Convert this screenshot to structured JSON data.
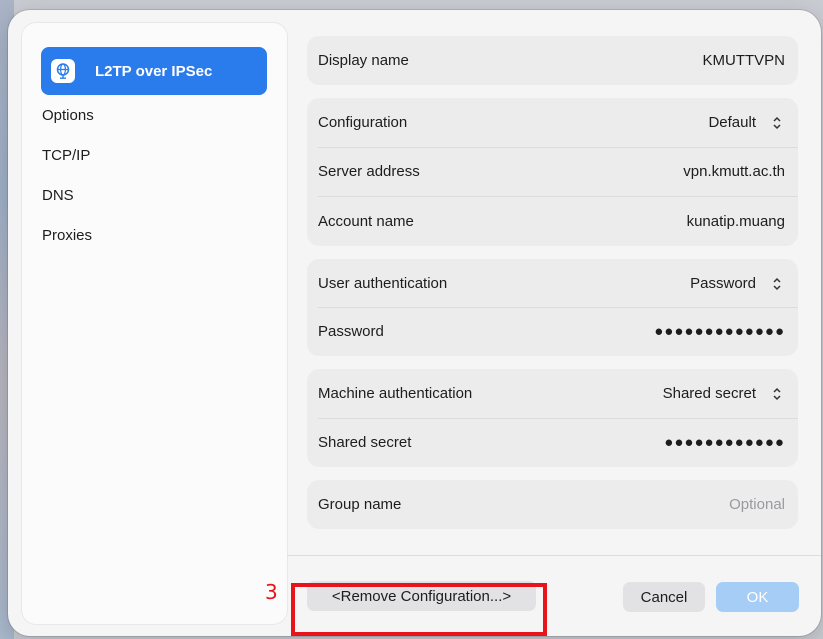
{
  "sidebar": {
    "selected": {
      "label": "L2TP over IPSec",
      "icon": "globe-network-icon"
    },
    "items": [
      {
        "label": "Options"
      },
      {
        "label": "TCP/IP"
      },
      {
        "label": "DNS"
      },
      {
        "label": "Proxies"
      }
    ]
  },
  "fields": {
    "display_name": {
      "label": "Display name",
      "value": "KMUTTVPN"
    },
    "configuration": {
      "label": "Configuration",
      "value": "Default"
    },
    "server_address": {
      "label": "Server address",
      "value": "vpn.kmutt.ac.th"
    },
    "account_name": {
      "label": "Account name",
      "value": "kunatip.muang"
    },
    "user_authentication": {
      "label": "User authentication",
      "value": "Password"
    },
    "password": {
      "label": "Password",
      "value": "●●●●●●●●●●●●●"
    },
    "machine_authentication": {
      "label": "Machine authentication",
      "value": "Shared secret"
    },
    "shared_secret": {
      "label": "Shared secret",
      "value": "●●●●●●●●●●●●"
    },
    "group_name": {
      "label": "Group name",
      "placeholder": "Optional"
    }
  },
  "buttons": {
    "remove": "<Remove Configuration...>",
    "cancel": "Cancel",
    "ok": "OK"
  },
  "annotation": {
    "number": "3",
    "color": "#e8141b"
  },
  "colors": {
    "accent": "#2a7bec",
    "ok_disabled": "#a6cdf6"
  }
}
